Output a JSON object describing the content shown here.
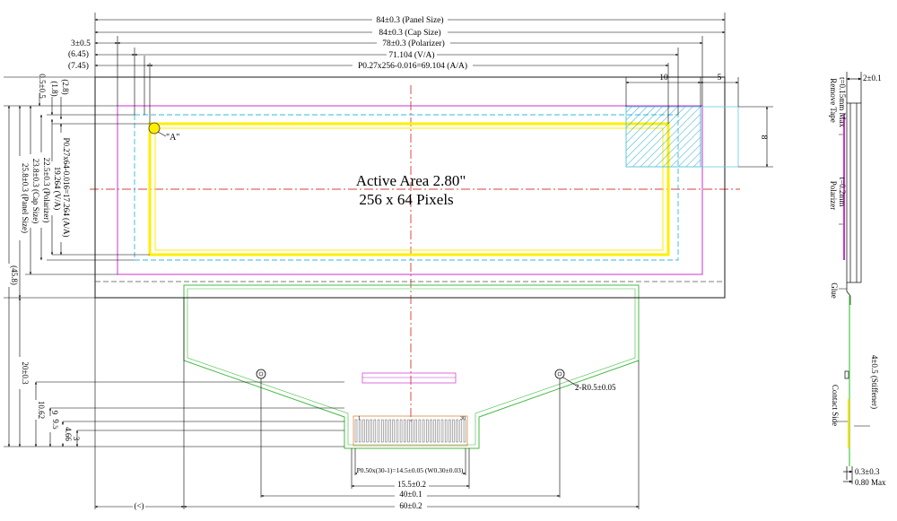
{
  "colors": {
    "line": "#000000",
    "panel": "#1a1a1a",
    "cap": "#cc33cc",
    "polarizer": "#33bbdd",
    "active": "#ffee00",
    "fpc": "#44bb44",
    "center": "#cc0000",
    "hatch": "#22aacc",
    "stiffener": "#44cc44",
    "contact": "#ffdd00"
  },
  "center_text": {
    "line1": "Active Area 2.80\"",
    "line2": "256 x 64 Pixels"
  },
  "top_dims": {
    "panel_size": "84±0.3 (Panel Size)",
    "cap_size": "84±0.3 (Cap Size)",
    "polarizer_offset": "3±0.5",
    "polarizer": "78±0.3 (Polarizer)",
    "va_offset": "(6.45)",
    "va": "71.104 (V/A)",
    "aa_offset": "(7.45)",
    "aa": "P0.27x256-0.016=69.104 (A/A)",
    "corner_w": "10",
    "corner_w2": "5",
    "corner_h": "8"
  },
  "left_dims": {
    "d05": "0.5±0.5",
    "d28": "(2.8)",
    "d18": "(1.8)",
    "aa": "P0.27x64-0.016=17.264 (A/A)",
    "va": "19.264 (V/A)",
    "polarizer": "22.5±0.3 (Polarizer)",
    "cap": "23.8±0.3 (Cap Size)",
    "panel": "25.8±0.3 (Panel Size)",
    "total": "(45.8)",
    "fpc_len": "20±0.3",
    "d1062": "10.62",
    "d9": "9",
    "d95": "9.5",
    "d466": "4.66",
    "d3": "3"
  },
  "bottom_dims": {
    "pitch": "P0.50x(30-1)=14.5±0.05 (W0.30±0.03)",
    "d155": "15.5±0.2",
    "d40": "40±0.1",
    "d60": "60±0.2",
    "offset": "(<)"
  },
  "labels": {
    "point_a": "\"A\"",
    "hole": "2-R0.5±0.05",
    "pin1": "1",
    "pin30": "30"
  },
  "side_view": {
    "thickness": "2±0.1",
    "remove_tape": "Remove Tape",
    "tape_thickness": "t=0.15mm Max",
    "polarizer": "Polarizer",
    "polarizer_thickness": "t=0.2mm",
    "glue": "Glue",
    "stiffener": "4±0.5 (Stiffener)",
    "contact_side": "Contact Side",
    "d03": "0.3±0.3",
    "d080": "0.80 Max"
  }
}
